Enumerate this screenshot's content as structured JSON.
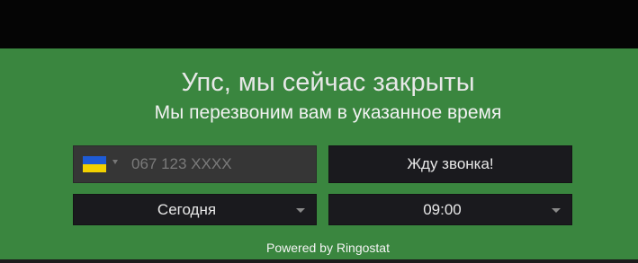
{
  "widget": {
    "title": "Упс, мы сейчас закрыты",
    "subtitle": "Мы перезвоним вам в указанное время",
    "phone": {
      "country_flag": "ua-flag-icon",
      "value": "",
      "placeholder": "067 123 XXXX"
    },
    "call_button_label": "Жду звонка!",
    "day_select": {
      "selected": "Сегодня"
    },
    "time_select": {
      "selected": "09:00"
    },
    "powered_by": "Powered by Ringostat"
  },
  "colors": {
    "widget_background": "#3a863f",
    "control_background": "#1a1a1e",
    "phone_field_background": "#363636",
    "flag_blue": "#1e5bd6",
    "flag_yellow": "#f2d100"
  }
}
